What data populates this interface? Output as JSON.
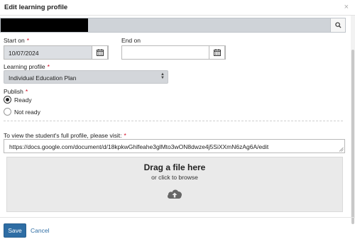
{
  "modal": {
    "title": "Edit learning profile",
    "close_glyph": "×"
  },
  "search": {
    "button_icon": "search-icon"
  },
  "start_on": {
    "label": "Start on",
    "required_mark": "*",
    "value": "10/07/2024",
    "icon": "calendar-icon"
  },
  "end_on": {
    "label": "End on",
    "value": "",
    "icon": "calendar-icon"
  },
  "learning_profile": {
    "label": "Learning profile",
    "required_mark": "*",
    "selected": "Individual Education Plan",
    "arrows_up": "▲",
    "arrows_down": "▼"
  },
  "publish": {
    "label": "Publish",
    "required_mark": "*",
    "options": [
      {
        "label": "Ready",
        "checked": true
      },
      {
        "label": "Not ready",
        "checked": false
      }
    ]
  },
  "profile_link": {
    "label": "To view the student's full profile, please visit:",
    "required_mark": "*",
    "value": "https://docs.google.com/document/d/18kpkwGhlfeahe3glMto3wON8dwze4j5SiXXmN6zAg6A/edit"
  },
  "dropzone": {
    "title": "Drag a file here",
    "subtitle": "or click to browse",
    "icon": "cloud-upload-icon"
  },
  "footer": {
    "save_label": "Save",
    "cancel_label": "Cancel"
  },
  "colors": {
    "primary": "#2e6da4",
    "required": "#d0021b",
    "filled_bg": "#dcdfe3"
  }
}
